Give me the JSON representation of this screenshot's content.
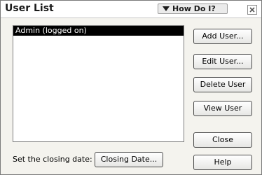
{
  "window": {
    "title": "User List",
    "how_do_i_label": "How Do I?"
  },
  "user_list": {
    "items": [
      {
        "label": "Admin (logged on)",
        "selected": true
      }
    ]
  },
  "buttons": {
    "add_user": "Add User...",
    "edit_user": "Edit User...",
    "delete_user": "Delete User",
    "view_user": "View User",
    "close": "Close",
    "help": "Help",
    "closing_date": "Closing Date..."
  },
  "closing_date_label": "Set the closing date:",
  "icons": {
    "how_do_i": "triangle-down-icon",
    "window_close": "close-icon"
  },
  "colors": {
    "selection_bg": "#000000",
    "selection_text": "#ffffff"
  }
}
